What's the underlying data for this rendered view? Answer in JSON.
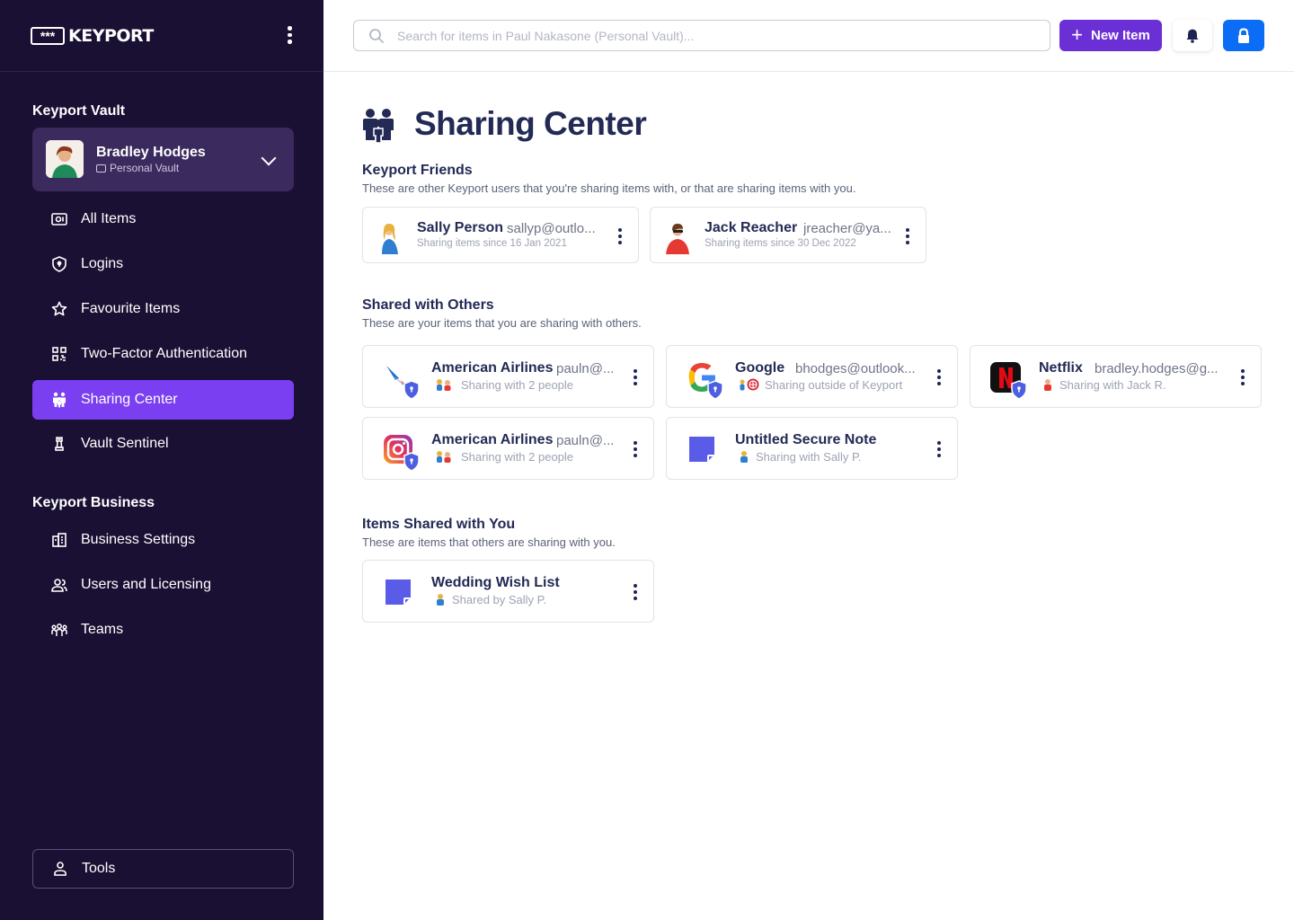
{
  "sidebar": {
    "brand": "KEYPORT",
    "logo_glyphs": "***",
    "vault_section_title": "Keyport Vault",
    "vault": {
      "name": "Bradley Hodges",
      "type": "Personal Vault"
    },
    "items": [
      {
        "label": "All Items",
        "icon": "vault-icon"
      },
      {
        "label": "Logins",
        "icon": "shield-icon"
      },
      {
        "label": "Favourite Items",
        "icon": "star-icon"
      },
      {
        "label": "Two-Factor Authentication",
        "icon": "qr-icon"
      },
      {
        "label": "Sharing Center",
        "icon": "people-icon",
        "active": true
      },
      {
        "label": "Vault Sentinel",
        "icon": "chess-rook-icon"
      }
    ],
    "business_section_title": "Keyport Business",
    "business_items": [
      {
        "label": "Business Settings",
        "icon": "building-icon"
      },
      {
        "label": "Users and Licensing",
        "icon": "users-icon"
      },
      {
        "label": "Teams",
        "icon": "team-icon"
      }
    ],
    "tools_label": "Tools"
  },
  "topbar": {
    "search_placeholder": "Search for items in Paul Nakasone (Personal Vault)...",
    "new_item_label": "New Item"
  },
  "page": {
    "title": "Sharing Center",
    "friends": {
      "title": "Keyport Friends",
      "description": "These are other Keyport users that you're sharing items with, or that are sharing items with you.",
      "cards": [
        {
          "name": "Sally Person",
          "email": "sallyp@outlo...",
          "since": "Sharing items since 16 Jan 2021"
        },
        {
          "name": "Jack Reacher",
          "email": "jreacher@ya...",
          "since": "Sharing items since 30 Dec 2022"
        }
      ]
    },
    "shared_with_others": {
      "title": "Shared with Others",
      "description": "These are your items that you are sharing with others.",
      "cards": [
        {
          "name": "American Airlines",
          "email": "pauln@...",
          "status": "Sharing with 2 people",
          "icon": "american-airlines-logo"
        },
        {
          "name": "Google",
          "email": "bhodges@outlook...",
          "status": "Sharing outside of Keyport",
          "icon": "google-logo"
        },
        {
          "name": "Netflix",
          "email": "bradley.hodges@g...",
          "status": "Sharing with Jack R.",
          "icon": "netflix-logo"
        },
        {
          "name": "American Airlines",
          "email": "pauln@...",
          "status": "Sharing with 2 people",
          "icon": "instagram-logo"
        },
        {
          "name": "Untitled Secure Note",
          "email": "",
          "status": "Sharing with Sally P.",
          "icon": "note-icon"
        }
      ]
    },
    "shared_with_you": {
      "title": "Items Shared with You",
      "description": "These are items that others are sharing with you.",
      "cards": [
        {
          "name": "Wedding Wish List",
          "status": "Shared by Sally P.",
          "icon": "note-icon"
        }
      ]
    }
  },
  "colors": {
    "sidebar_bg": "#1a1033",
    "active_nav": "#7b3ff2",
    "primary_button": "#6b2fd6",
    "lock_button": "#0b6cf5",
    "shield_badge": "#4c5fe0",
    "note_icon": "#5a5ce8"
  }
}
